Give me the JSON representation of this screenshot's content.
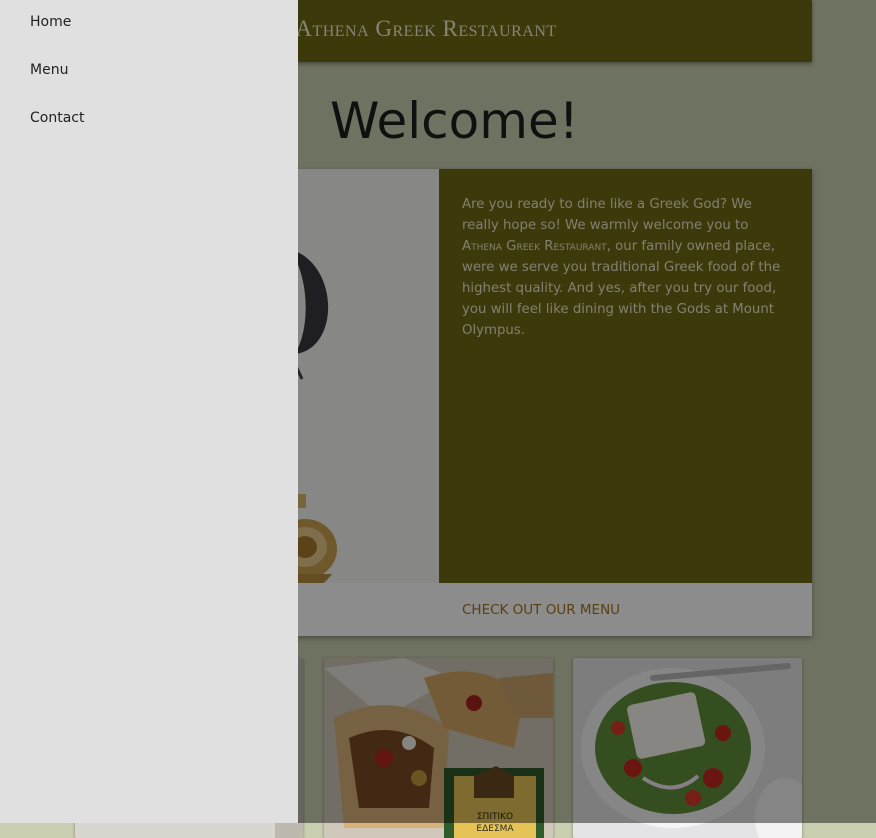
{
  "header": {
    "title": "Athena Greek Restaurant"
  },
  "main": {
    "heading": "Welcome!",
    "card": {
      "intro_text": "Are you ready to dine like a Greek God? We really hope so! We warmly welcome you to",
      "restaurant_name": "Athena Greek Restaurant",
      "rest_text": ", our family owned place, were we serve you traditional Greek food of the highest quality. And yes, after you try our food, you will feel like dining with the Gods at Mount Olympus.",
      "action_label": "CHECK OUT OUR MENU"
    },
    "thumbnails": [
      {
        "icon": "food-photo-partial"
      },
      {
        "icon": "gyros-photo",
        "box_text_line1": "ΣΠΙΤΙΚΟ",
        "box_text_line2": "ΕΔΕΣΜΑ"
      },
      {
        "icon": "greek-salad-photo"
      }
    ]
  },
  "drawer": {
    "items": [
      {
        "label": "Home"
      },
      {
        "label": "Menu"
      },
      {
        "label": "Contact"
      }
    ]
  },
  "colors": {
    "brand_olive": "#6e6915",
    "background": "#c9cfb0",
    "drawer_bg": "#e0e0e0",
    "link_accent": "#a2761e",
    "overlay": "rgba(0,0,0,0.45)"
  }
}
